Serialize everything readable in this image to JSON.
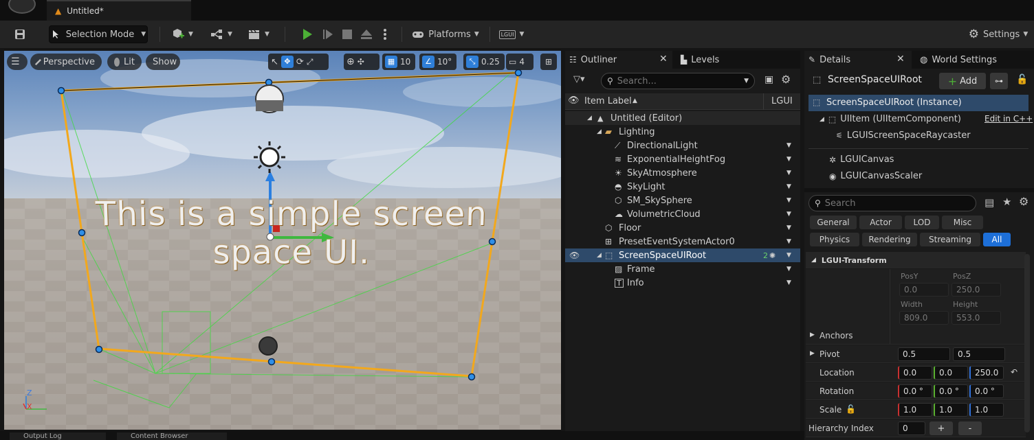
{
  "title_tab": {
    "name": "Untitled*"
  },
  "toolbar": {
    "selection_mode": "Selection Mode",
    "platforms": "Platforms",
    "lgui": "LGUI",
    "settings": "Settings"
  },
  "viewport": {
    "perspective": "Perspective",
    "lit": "Lit",
    "show": "Show",
    "grid_snap": "10",
    "rot_snap": "10°",
    "scale_snap": "0.25",
    "camera_speed": "4",
    "ui_text_line1": "This is a simple screen",
    "ui_text_line2": "space UI.",
    "axis_z": "Z",
    "axis_x": "X"
  },
  "outliner": {
    "tab_label": "Outliner",
    "levels_tab": "Levels",
    "search_placeholder": "Search...",
    "col_item_label": "Item Label",
    "col_type": "LGUI",
    "rows": [
      {
        "label": "Untitled (Editor)"
      },
      {
        "label": "Lighting"
      },
      {
        "label": "DirectionalLight"
      },
      {
        "label": "ExponentialHeightFog"
      },
      {
        "label": "SkyAtmosphere"
      },
      {
        "label": "SkyLight"
      },
      {
        "label": "SM_SkySphere"
      },
      {
        "label": "VolumetricCloud"
      },
      {
        "label": "Floor"
      },
      {
        "label": "PresetEventSystemActor0"
      },
      {
        "label": "ScreenSpaceUIRoot",
        "badge": "2"
      },
      {
        "label": "Frame"
      },
      {
        "label": "Info"
      }
    ]
  },
  "details": {
    "tab_label": "Details",
    "world_settings_tab": "World Settings",
    "actor_name": "ScreenSpaceUIRoot",
    "add_button": "Add",
    "instance": "ScreenSpaceUIRoot (Instance)",
    "ui_item": "UIItem (UIItemComponent)",
    "edit_cpp": "Edit in C++",
    "raycaster": "LGUIScreenSpaceRaycaster",
    "canvas": "LGUICanvas",
    "canvas_scaler": "LGUICanvasScaler",
    "search_placeholder": "Search",
    "filters": [
      "General",
      "Actor",
      "LOD",
      "Misc",
      "Physics",
      "Rendering",
      "Streaming",
      "All"
    ],
    "section": "LGUI-Transform",
    "pos_y_label": "PosY",
    "pos_z_label": "PosZ",
    "pos_y": "0.0",
    "pos_z": "250.0",
    "width_label": "Width",
    "height_label": "Height",
    "width": "809.0",
    "height": "553.0",
    "anchors": "Anchors",
    "pivot": "Pivot",
    "pivot_x": "0.5",
    "pivot_y": "0.5",
    "location": "Location",
    "loc_x": "0.0",
    "loc_y": "0.0",
    "loc_z": "250.0",
    "rotation": "Rotation",
    "rot_x": "0.0 °",
    "rot_y": "0.0 °",
    "rot_z": "0.0 °",
    "scale": "Scale",
    "scale_x": "1.0",
    "scale_y": "1.0",
    "scale_z": "1.0",
    "hierarchy_index": "Hierarchy Index",
    "hierarchy_value": "0",
    "plus": "+",
    "minus": "-"
  },
  "bottom": {
    "tab1": "Output Log",
    "tab2": "Content Browser"
  },
  "colors": {
    "accent": "#1d6fd8",
    "selection": "#2e4a6a",
    "play_green": "#4caf36",
    "warning": "#e08a1a"
  }
}
